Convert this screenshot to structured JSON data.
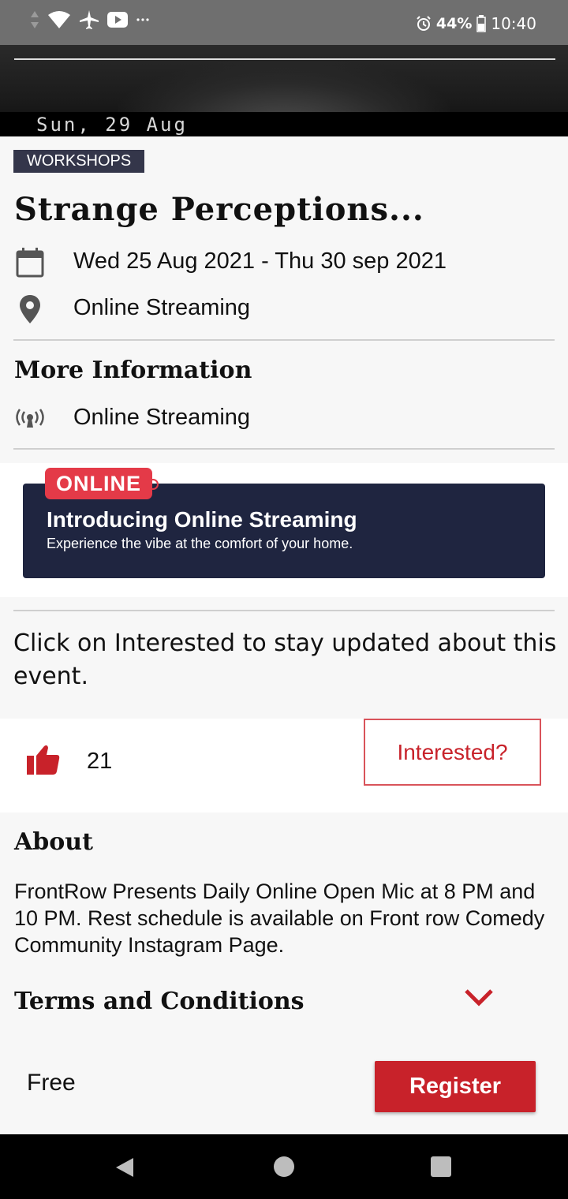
{
  "status_bar": {
    "battery": "44%",
    "time": "10:40",
    "icons": [
      "data-arrows-icon",
      "wifi-icon",
      "airplane-icon",
      "youtube-icon",
      "more-icon",
      "alarm-icon",
      "battery-icon"
    ]
  },
  "hero": {
    "date_text": "Sun, 29 Aug"
  },
  "event": {
    "category": "WORKSHOPS",
    "title": "Strange Perceptions...",
    "date_range": "Wed 25 Aug 2021 - Thu 30 sep 2021",
    "location": "Online Streaming"
  },
  "more_info": {
    "heading": "More Information",
    "streaming": "Online Streaming"
  },
  "banner": {
    "badge": "ONLINE",
    "title": "Introducing Online Streaming",
    "subtitle": "Experience the vibe at the comfort of your home."
  },
  "notice": "Click on Interested to stay updated about this event.",
  "interest": {
    "count": "21",
    "button_label": "Interested?"
  },
  "about": {
    "heading": "About",
    "text": "FrontRow Presents Daily Online Open Mic at 8 PM and 10 PM. Rest schedule is available on Front row Comedy Community Instagram Page."
  },
  "terms": {
    "heading": "Terms and Conditions"
  },
  "footer": {
    "price": "Free",
    "register_label": "Register"
  },
  "colors": {
    "accent": "#c8222a",
    "tag_bg": "#34364a",
    "banner_bg": "#1f2540",
    "badge": "#e43a48"
  }
}
